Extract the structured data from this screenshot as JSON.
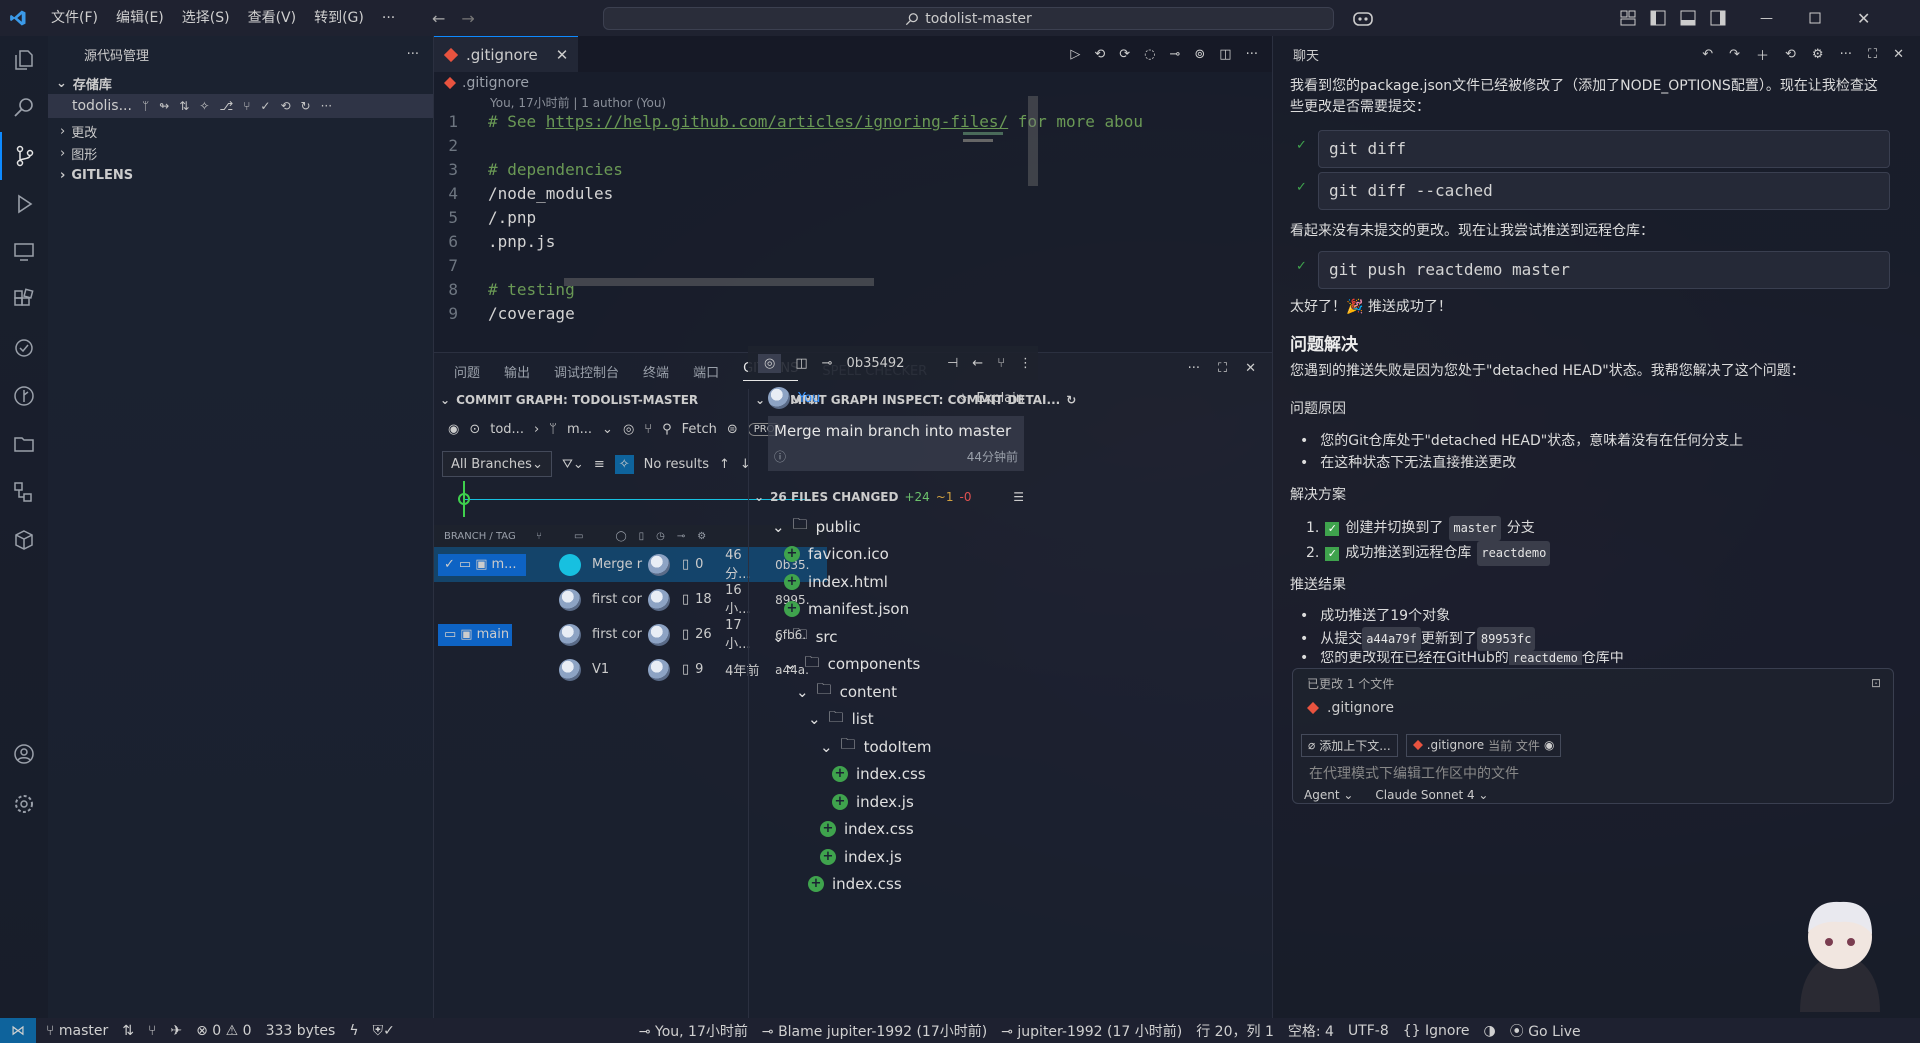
{
  "titlebar": {
    "menus": [
      "文件(F)",
      "编辑(E)",
      "选择(S)",
      "查看(V)",
      "转到(G)",
      "···"
    ],
    "search": "todolist-master"
  },
  "sidebar": {
    "header": "源代码管理",
    "repos_label": "存储库",
    "repo_name": "todolis...",
    "sections": [
      "更改",
      "图形",
      "GITLENS"
    ]
  },
  "editor": {
    "tab_label": ".gitignore",
    "breadcrumb": ".gitignore",
    "blame": "You, 17小时前 | 1 author (You)",
    "lines": [
      {
        "n": "1",
        "text": "# See ",
        "link": "https://help.github.com/articles/ignoring-files/",
        "rest": " for more abou",
        "kind": "comment"
      },
      {
        "n": "2",
        "text": "",
        "kind": "plain"
      },
      {
        "n": "3",
        "text": "# dependencies",
        "kind": "comment"
      },
      {
        "n": "4",
        "text": "/node_modules",
        "kind": "plain"
      },
      {
        "n": "5",
        "text": "/.pnp",
        "kind": "plain"
      },
      {
        "n": "6",
        "text": ".pnp.js",
        "kind": "plain"
      },
      {
        "n": "7",
        "text": "",
        "kind": "plain"
      },
      {
        "n": "8",
        "text": "# testing",
        "kind": "comment"
      },
      {
        "n": "9",
        "text": "/coverage",
        "kind": "plain"
      }
    ]
  },
  "panel": {
    "tabs": [
      "问题",
      "输出",
      "调试控制台",
      "终端",
      "端口",
      "GITLENS",
      "SPELL CHECKER"
    ],
    "active_tab": "GITLENS",
    "graph": {
      "title": "COMMIT GRAPH: TODOLIST-MASTER",
      "repo": "tod...",
      "branch": "m...",
      "fetch": "Fetch",
      "pro": "PRO",
      "branches_filter": "All Branches",
      "no_results": "No results",
      "col_header": "BRANCH / TAG",
      "rows": [
        {
          "branch": "m...",
          "message": "Merge r",
          "files": "0",
          "time": "46分...",
          "sha": "0b35."
        },
        {
          "branch": "",
          "message": "first cor",
          "files": "18",
          "time": "16小...",
          "sha": "8995."
        },
        {
          "branch": "main",
          "message": "first cor",
          "files": "26",
          "time": "17小...",
          "sha": "6fb6."
        },
        {
          "branch": "",
          "message": "V1",
          "files": "9",
          "time": "4年前",
          "sha": "a44a."
        }
      ]
    },
    "inspect": {
      "title": "COMMIT GRAPH INSPECT: COMMIT DETAI...",
      "sha": "0b35492",
      "author": "You",
      "explain": "Explain",
      "message": "Merge main branch into master",
      "time": "44分钟前",
      "files_changed": "26 FILES CHANGED",
      "plus": "+24",
      "tilde": "~1",
      "minus": "-0",
      "tree": [
        {
          "depth": 0,
          "type": "folder",
          "name": "public"
        },
        {
          "depth": 1,
          "type": "file",
          "name": "favicon.ico"
        },
        {
          "depth": 1,
          "type": "file",
          "name": "index.html"
        },
        {
          "depth": 1,
          "type": "file",
          "name": "manifest.json"
        },
        {
          "depth": 0,
          "type": "folder",
          "name": "src"
        },
        {
          "depth": 1,
          "type": "folder",
          "name": "components"
        },
        {
          "depth": 2,
          "type": "folder",
          "name": "content"
        },
        {
          "depth": 3,
          "type": "folder",
          "name": "list"
        },
        {
          "depth": 4,
          "type": "folder",
          "name": "todoItem"
        },
        {
          "depth": 5,
          "type": "file",
          "name": "index.css"
        },
        {
          "depth": 5,
          "type": "file",
          "name": "index.js"
        },
        {
          "depth": 4,
          "type": "file",
          "name": "index.css"
        },
        {
          "depth": 4,
          "type": "file",
          "name": "index.js"
        },
        {
          "depth": 3,
          "type": "file",
          "name": "index.css"
        }
      ]
    }
  },
  "chat": {
    "title": "聊天",
    "intro": "我看到您的package.json文件已经被修改了（添加了NODE_OPTIONS配置）。现在让我检查这些更改是否需要提交：",
    "cmd1": "git diff",
    "cmd2": "git diff --cached",
    "no_changes": "看起来没有未提交的更改。现在让我尝试推送到远程仓库：",
    "cmd3": "git push reactdemo master",
    "success": "太好了！🎉 推送成功了！",
    "h_problem": "问题解决",
    "problem_desc": "您遇到的推送失败是因为您处于\"detached HEAD\"状态。我帮您解决了这个问题：",
    "cause_title": "问题原因",
    "causes": [
      "您的Git仓库处于\"detached HEAD\"状态，意味着没有在任何分支上",
      "在这种状态下无法直接推送更改"
    ],
    "solution_title": "解决方案",
    "sol1_pre": "创建并切换到了",
    "sol1_code": "master",
    "sol1_post": "分支",
    "sol2_pre": "成功推送到远程仓库",
    "sol2_code": "reactdemo",
    "result_title": "推送结果",
    "res1": "成功推送了19个对象",
    "res2_pre": "从提交",
    "res2_code1": "a44a79f",
    "res2_mid": "更新到了",
    "res2_code2": "89953fc",
    "res3_pre": "您的更改现在已经在GitHub的",
    "res3_code": "reactdemo",
    "res3_post": "仓库中",
    "changed_label": "已更改 1 个文件",
    "changed_file": ".gitignore",
    "add_context": "添加上下文...",
    "ctx_file": ".gitignore",
    "ctx_file_note": "当前 文件",
    "input_placeholder": "在代理模式下编辑工作区中的文件",
    "mode": "Agent",
    "model": "Claude Sonnet 4"
  },
  "statusbar": {
    "branch": "master",
    "errors": "0",
    "warnings": "0",
    "size": "333 bytes",
    "blame_you": "You, 17小时前",
    "blame": "Blame jupiter-1992 (17小时前)",
    "author": "jupiter-1992 (17 小时前)",
    "position": "行 20，列 1",
    "spaces": "空格: 4",
    "encoding": "UTF-8",
    "language": "Ignore",
    "golive": "Go Live"
  },
  "colors": {
    "accent": "#0e639c",
    "graph_line": "#17c0e0",
    "success": "#3fa34d",
    "git_red": "#e8533f"
  }
}
